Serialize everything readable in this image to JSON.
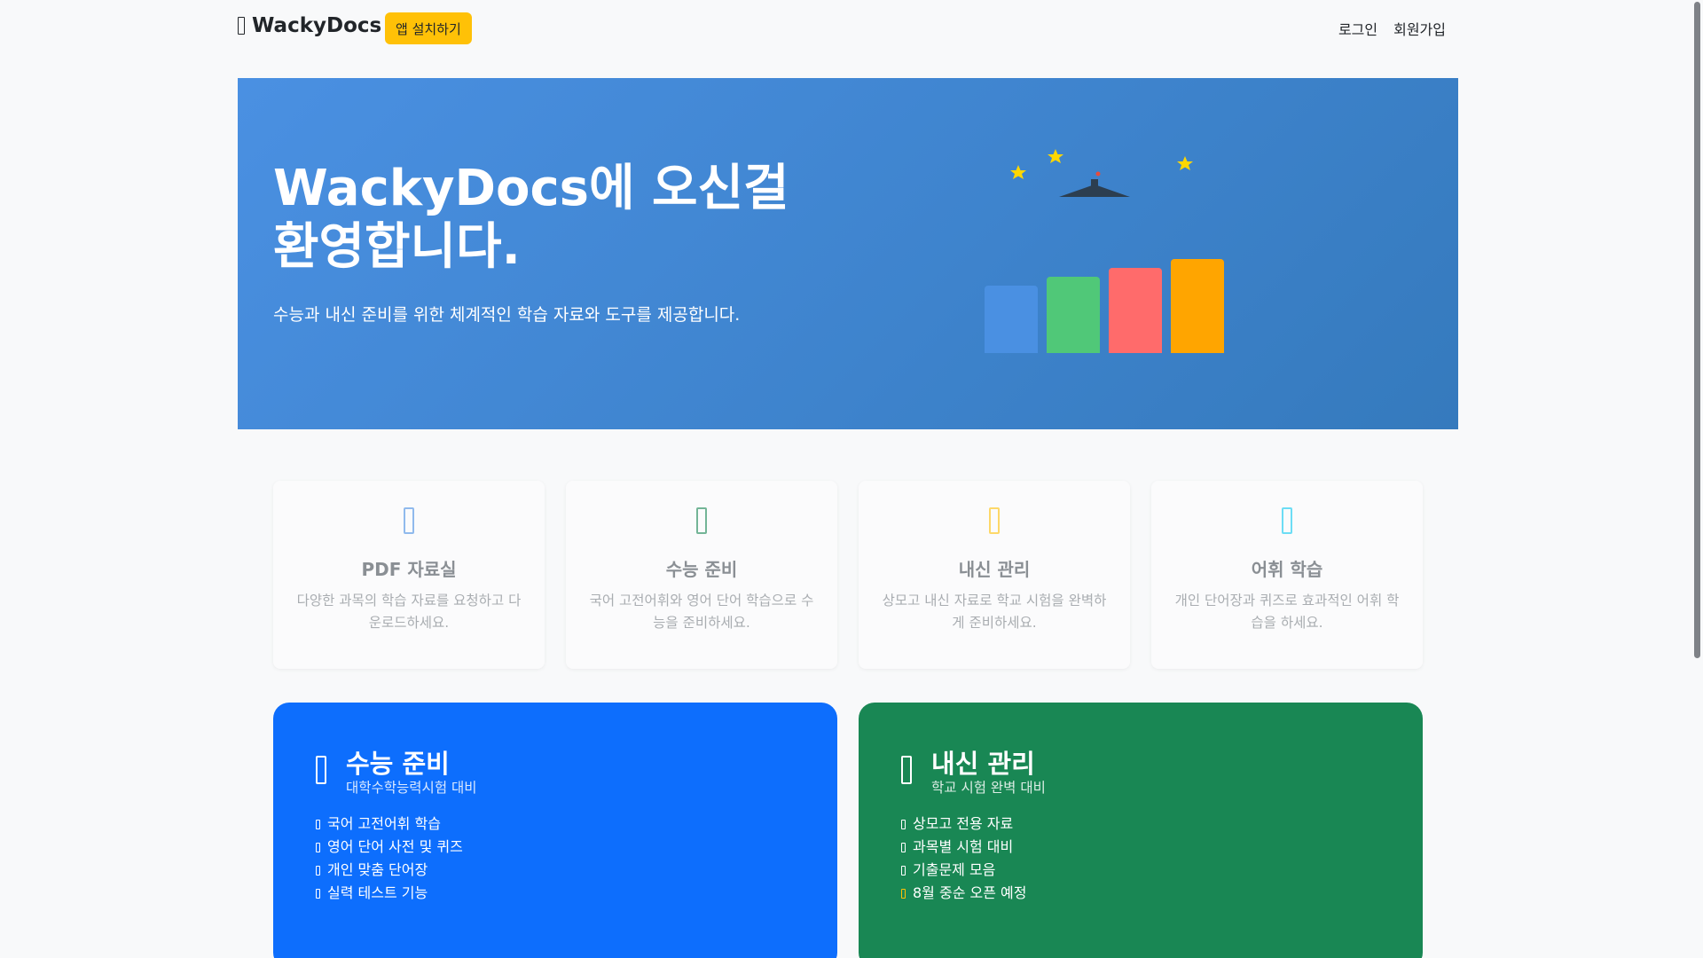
{
  "header": {
    "brand": "WackyDocs",
    "install_label": "앱 설치하기",
    "nav": {
      "login": "로그인",
      "signup": "회원가입"
    }
  },
  "hero": {
    "title": "WackyDocs에 오신걸 환영합니다.",
    "subtitle": "수능과 내신 준비를 위한 체계적인 학습 자료와 도구를 제공합니다.",
    "illustration_colors": [
      "#4a90e2",
      "#50c878",
      "#ff6b6b",
      "#ffa500"
    ]
  },
  "features": [
    {
      "title": "PDF 자료실",
      "desc": "다양한 과목의 학습 자료를 요청하고 다운로드하세요.",
      "icon": "file-pdf-icon",
      "color": "#4a90e2"
    },
    {
      "title": "수능 준비",
      "desc": "국어 고전어휘와 영어 단어 학습으로 수능을 준비하세요.",
      "icon": "book-icon",
      "color": "#198754"
    },
    {
      "title": "내신 관리",
      "desc": "상모고 내신 자료로 학교 시험을 완벽하게 준비하세요.",
      "icon": "school-icon",
      "color": "#ffc107"
    },
    {
      "title": "어휘 학습",
      "desc": "개인 단어장과 퀴즈로 효과적인 어휘 학습을 하세요.",
      "icon": "vocab-icon",
      "color": "#0dcaf0"
    }
  ],
  "panels": [
    {
      "title": "수능 준비",
      "subtitle": "대학수학능력시험 대비",
      "items": [
        "국어 고전어휘 학습",
        "영어 단어 사전 및 퀴즈",
        "개인 맞춤 단어장",
        "실력 테스트 기능"
      ],
      "color": "#0d6efd"
    },
    {
      "title": "내신 관리",
      "subtitle": "학교 시험 완벽 대비",
      "items": [
        "상모고 전용 자료",
        "과목별 시험 대비",
        "기출문제 모음",
        "8월 중순 오픈 예정"
      ],
      "color": "#198754"
    }
  ]
}
